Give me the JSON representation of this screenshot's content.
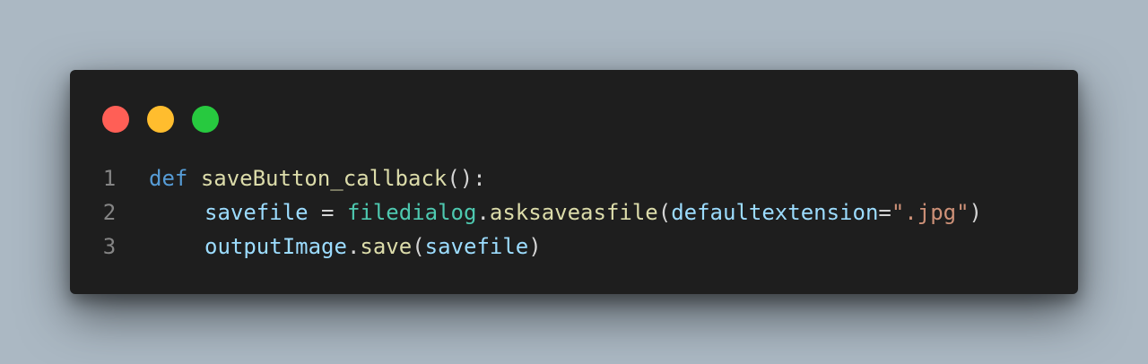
{
  "window": {
    "controls": [
      {
        "name": "close",
        "color": "#ff5f56"
      },
      {
        "name": "minimize",
        "color": "#ffbd2e"
      },
      {
        "name": "maximize",
        "color": "#27c93f"
      }
    ]
  },
  "code": {
    "lines": [
      {
        "number": "1",
        "indent": false,
        "tokens": [
          {
            "text": "def",
            "kind": "keyword"
          },
          {
            "text": " ",
            "kind": "punct"
          },
          {
            "text": "saveButton_callback",
            "kind": "func"
          },
          {
            "text": "():",
            "kind": "punct"
          }
        ]
      },
      {
        "number": "2",
        "indent": true,
        "tokens": [
          {
            "text": "savefile",
            "kind": "var"
          },
          {
            "text": " = ",
            "kind": "op"
          },
          {
            "text": "filedialog",
            "kind": "module"
          },
          {
            "text": ".",
            "kind": "punct"
          },
          {
            "text": "asksaveasfile",
            "kind": "func"
          },
          {
            "text": "(",
            "kind": "punct"
          },
          {
            "text": "defaultextension",
            "kind": "var"
          },
          {
            "text": "=",
            "kind": "op"
          },
          {
            "text": "\".jpg\"",
            "kind": "string"
          },
          {
            "text": ")",
            "kind": "punct"
          }
        ]
      },
      {
        "number": "3",
        "indent": true,
        "tokens": [
          {
            "text": "outputImage",
            "kind": "var"
          },
          {
            "text": ".",
            "kind": "punct"
          },
          {
            "text": "save",
            "kind": "func"
          },
          {
            "text": "(",
            "kind": "punct"
          },
          {
            "text": "savefile",
            "kind": "var"
          },
          {
            "text": ")",
            "kind": "punct"
          }
        ]
      }
    ]
  }
}
